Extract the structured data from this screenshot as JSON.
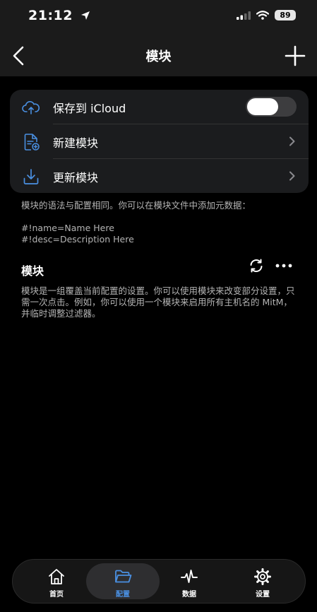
{
  "status": {
    "time": "21:12",
    "battery": "89",
    "icons": [
      "location-arrow-icon",
      "signal-icon",
      "wifi-icon",
      "battery-icon"
    ]
  },
  "nav": {
    "title": "模块",
    "back_icon": "chevron-left-icon",
    "add_icon": "plus-icon"
  },
  "card": {
    "rows": [
      {
        "label": "保存到 iCloud",
        "icon": "cloud-upload-icon",
        "control": "toggle",
        "toggle_on": false
      },
      {
        "label": "新建模块",
        "icon": "new-document-icon",
        "control": "chevron"
      },
      {
        "label": "更新模块",
        "icon": "download-icon",
        "control": "chevron"
      }
    ]
  },
  "hint": {
    "line1": "模块的语法与配置相同。你可以在模块文件中添加元数据：",
    "line2": "#!name=Name Here",
    "line3": "#!desc=Description Here"
  },
  "section": {
    "title": "模块",
    "description": "模块是一组覆盖当前配置的设置。你可以使用模块来改变部分设置，只需一次点击。例如，你可以使用一个模块来启用所有主机名的 MitM，并临时调整过滤器。",
    "actions": [
      "refresh-icon",
      "more-icon"
    ]
  },
  "tabbar": {
    "tabs": [
      {
        "label": "首页",
        "icon": "home-icon",
        "active": false
      },
      {
        "label": "配置",
        "icon": "folder-icon",
        "active": true
      },
      {
        "label": "数据",
        "icon": "activity-icon",
        "active": false
      },
      {
        "label": "设置",
        "icon": "gear-icon",
        "active": false
      }
    ]
  },
  "colors": {
    "accent": "#4a90e2",
    "background": "#000000",
    "card": "#1b1c1e",
    "secondary_text": "#b4b4b4"
  }
}
